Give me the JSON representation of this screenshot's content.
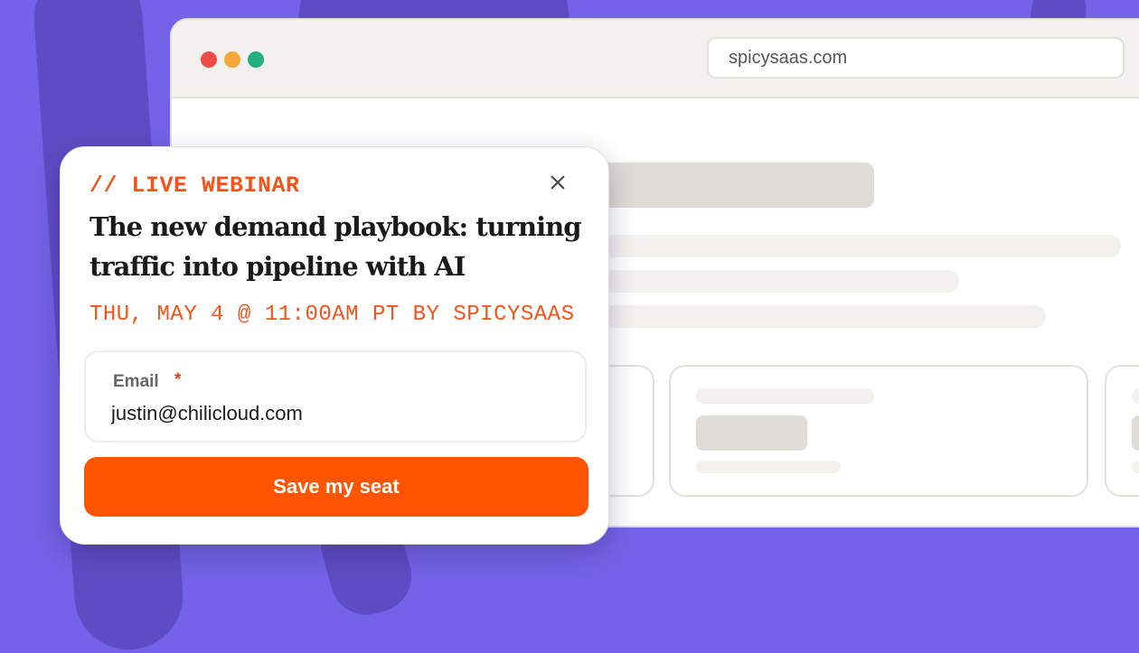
{
  "browser": {
    "url": "spicysaas.com"
  },
  "modal": {
    "eyebrow": "// LIVE WEBINAR",
    "headline": "The new demand playbook: turning traffic into pipeline with AI",
    "event_meta": "THU, MAY 4 @ 11:00AM PT BY SPICYSAAS",
    "email_field": {
      "label": "Email",
      "required_marker": "*",
      "value": "justin@chilicloud.com"
    },
    "submit_label": "Save my seat"
  },
  "icons": {
    "close": "close-icon"
  },
  "colors": {
    "background": "#7463E8",
    "accent": "#FF5500",
    "eyebrow_text": "#F2541B",
    "traffic_red": "#EE4B4B",
    "traffic_yellow": "#F5A83A",
    "traffic_green": "#22B07D"
  }
}
